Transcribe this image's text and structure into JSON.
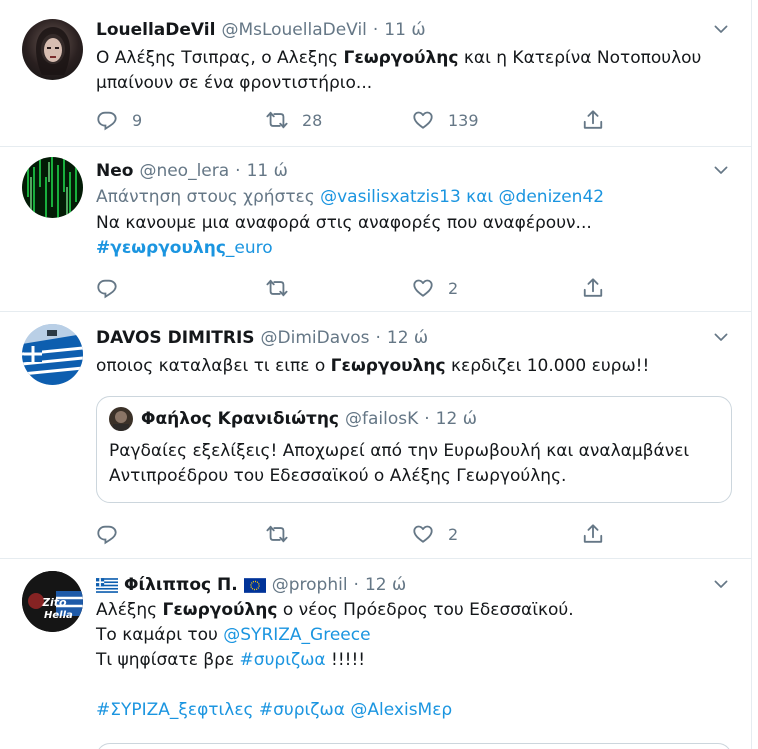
{
  "tweets": [
    {
      "name": "LouellaDeVil",
      "handle": "@MsLouellaDeVil",
      "time": "11 ώ",
      "text_a": "Ο Αλέξης Τσιπρας, ο Αλεξης ",
      "text_bold": "Γεωργούλης",
      "text_b": " και η Κατερίνα Νοτοπουλου",
      "text_line2": "μπαίνουν σε ένα φροντιστήριο...",
      "replies": "9",
      "retweets": "28",
      "likes": "139"
    },
    {
      "name": "Neo",
      "handle": "@neo_lera",
      "time": "11 ώ",
      "reply_prefix": "Απάντηση στους χρήστες ",
      "reply_users": "@vasilisxatzis13 και @denizen42",
      "text_line1": "Να κανουμε μια αναφορά στις αναφορές που αναφέρουν...",
      "hashtag_bold": "#γεωργουλης",
      "hashtag_rest": "_euro",
      "replies": "",
      "retweets": "",
      "likes": "2"
    },
    {
      "name": "DAVOS DIMITRIS",
      "handle": "@DimiDavos",
      "time": "12 ώ",
      "text_a": "οποιος καταλαβει τι ειπε ο ",
      "text_bold": "Γεωργουλης",
      "text_b": " κερδιζει 10.000 ευρω!!",
      "quote": {
        "name": "Φαήλος Κρανιδιώτης",
        "handle": "@failosK",
        "time": "12 ώ",
        "line1": "Ραγδαίες εξελίξεις! Αποχωρεί από την Ευρωβουλή και αναλαμβάνει",
        "line2": "Αντιπροέδρου του Εδεσσαϊκού ο Αλέξης Γεωργούλης."
      },
      "replies": "",
      "retweets": "",
      "likes": "2"
    },
    {
      "name": "Φίλιππος Π.",
      "handle": "@prophil",
      "time": "12 ώ",
      "avatar_text": "Zito\ni Hella",
      "line1_a": "Αλέξης ",
      "line1_bold": "Γεωργούλης",
      "line1_b": " ο νέος Πρόεδρος του Εδεσσαϊκού.",
      "line2_a": "Το καμάρι του ",
      "line2_link": "@SYRIZA_Greece",
      "line3_a": "Τι ψηφίσατε βρε ",
      "line3_link": "#συριζωα",
      "line3_b": " !!!!!",
      "line4": "#ΣΥΡΙΖΑ_ξεφτιλες #συριζωα @AlexisΜερ"
    }
  ],
  "colors": {
    "link": "#1b95e0",
    "muted": "#657786",
    "border": "#e6ecf0"
  }
}
